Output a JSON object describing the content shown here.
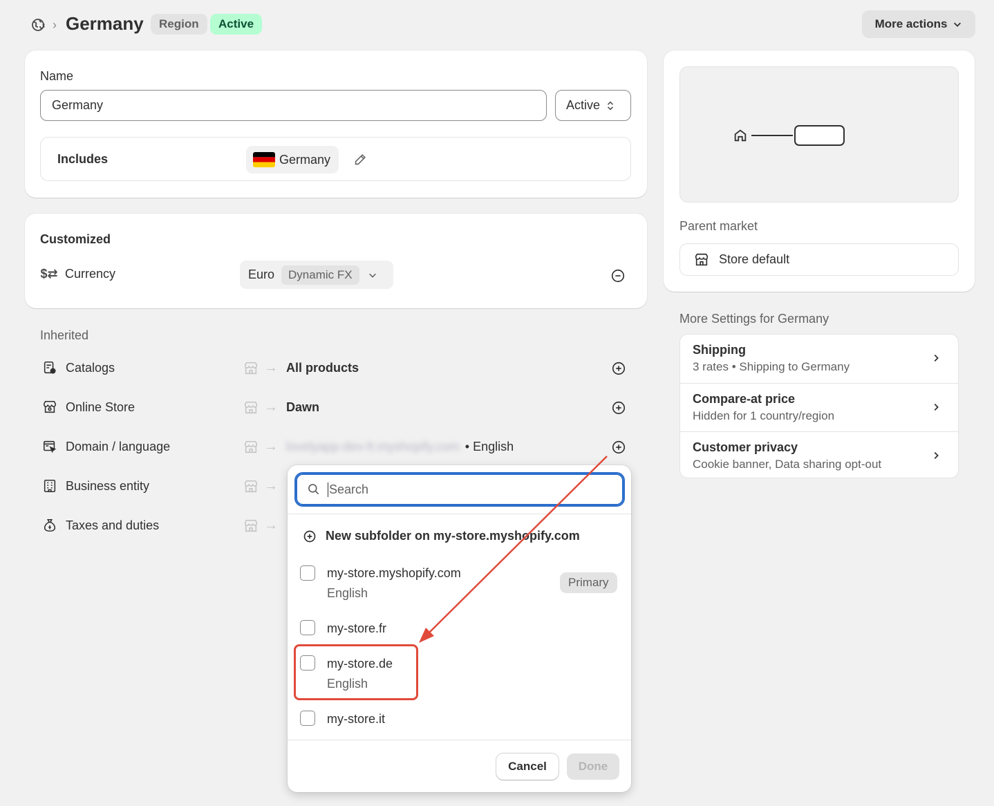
{
  "header": {
    "title": "Germany",
    "region_badge": "Region",
    "status_badge": "Active",
    "more_actions": "More actions"
  },
  "name_card": {
    "name_label": "Name",
    "name_value": "Germany",
    "status_select": "Active",
    "includes_label": "Includes",
    "includes_chip": "Germany"
  },
  "customized": {
    "heading": "Customized",
    "currency_label": "Currency",
    "currency_value": "Euro",
    "currency_tag": "Dynamic FX"
  },
  "inherited": {
    "heading": "Inherited",
    "rows": [
      {
        "label": "Catalogs",
        "value": "All products"
      },
      {
        "label": "Online Store",
        "value": "Dawn"
      },
      {
        "label": "Domain / language",
        "value": "lovelyapp-dev-fr.myshopify.com",
        "value_suffix": "• English"
      },
      {
        "label": "Business entity",
        "value": ""
      },
      {
        "label": "Taxes and duties",
        "value": ""
      }
    ]
  },
  "parent_market": {
    "label": "Parent market",
    "value": "Store default"
  },
  "more_settings": {
    "heading": "More Settings for Germany",
    "items": [
      {
        "title": "Shipping",
        "subtitle": "3 rates • Shipping to Germany"
      },
      {
        "title": "Compare-at price",
        "subtitle": "Hidden for 1 country/region"
      },
      {
        "title": "Customer privacy",
        "subtitle": "Cookie banner, Data sharing opt-out"
      }
    ]
  },
  "popover": {
    "search_placeholder": "Search",
    "new_subfolder": "New subfolder on my-store.myshopify.com",
    "options": [
      {
        "title": "my-store.myshopify.com",
        "subtitle": "English",
        "badge": "Primary",
        "checked": false
      },
      {
        "title": "my-store.fr",
        "subtitle": "",
        "checked": false
      },
      {
        "title": "my-store.de",
        "subtitle": "English",
        "checked": false
      },
      {
        "title": "my-store.it",
        "subtitle": "",
        "checked": false
      }
    ],
    "cancel": "Cancel",
    "done": "Done"
  },
  "colors": {
    "active_badge_bg": "#b4fed2",
    "active_badge_text": "#0c5132",
    "focus_ring": "#2c6ecb",
    "annotation_red": "#e04a3a"
  }
}
